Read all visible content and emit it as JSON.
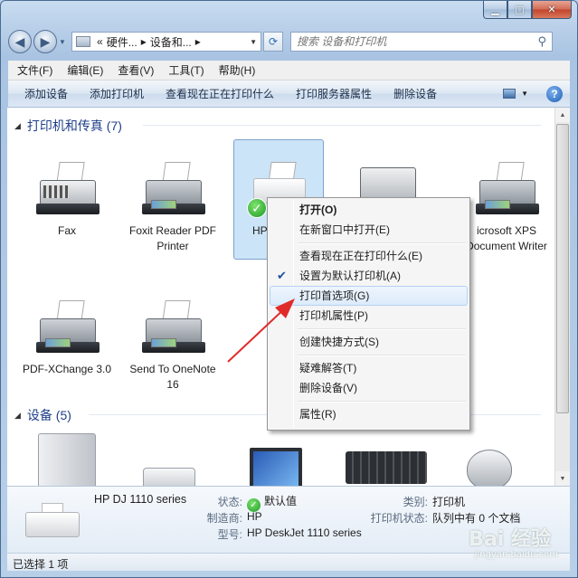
{
  "window": {
    "caption_buttons": [
      "minimize-icon",
      "maximize-icon",
      "close-icon"
    ]
  },
  "nav": {
    "back_icon": "back-arrow-icon",
    "forward_icon": "forward-arrow-icon",
    "breadcrumb_prefix": "«",
    "breadcrumb": [
      "硬件...",
      "设备和..."
    ],
    "search_placeholder": "搜索 设备和打印机"
  },
  "menubar": [
    "文件(F)",
    "编辑(E)",
    "查看(V)",
    "工具(T)",
    "帮助(H)"
  ],
  "commands": [
    "添加设备",
    "添加打印机",
    "查看现在正在打印什么",
    "打印服务器属性",
    "删除设备"
  ],
  "groups": {
    "printers_header": "打印机和传真 (7)",
    "devices_header": "设备 (5)"
  },
  "printers": [
    {
      "label": "Fax"
    },
    {
      "label": "Foxit Reader PDF Printer"
    },
    {
      "label": "HP"
    },
    {
      "label": ""
    },
    {
      "label": "icrosoft XPS Document Writer"
    },
    {
      "label": "PDF-XChange 3.0"
    },
    {
      "label": "Send To OneNote 16"
    }
  ],
  "context_menu": {
    "items": [
      {
        "label": "打开(O)",
        "bold": true
      },
      {
        "label": "在新窗口中打开(E)"
      },
      {
        "label": "查看现在正在打印什么(E)"
      },
      {
        "label": "设置为默认打印机(A)",
        "checked": true
      },
      {
        "label": "打印首选项(G)",
        "hot": true
      },
      {
        "label": "打印机属性(P)"
      },
      {
        "label": "创建快捷方式(S)"
      },
      {
        "label": "疑难解答(T)"
      },
      {
        "label": "删除设备(V)"
      },
      {
        "label": "属性(R)"
      }
    ]
  },
  "details": {
    "name": "HP DJ 1110 series",
    "state_label": "状态:",
    "state_value": "默认值",
    "maker_label": "制造商:",
    "maker_value": "HP",
    "model_label": "型号:",
    "model_value": "HP DeskJet 1110 series",
    "category_label": "类别:",
    "category_value": "打印机",
    "print_state_label": "打印机状态:",
    "print_state_value": "队列中有 0 个文档"
  },
  "status": "已选择 1 项",
  "watermark": "Bai 经验",
  "watermark_sub": "jingyan.baidu.com",
  "colors": {
    "accent": "#1e3f8a",
    "selection": "#cce4f7",
    "arrow": "#e02a2a"
  }
}
